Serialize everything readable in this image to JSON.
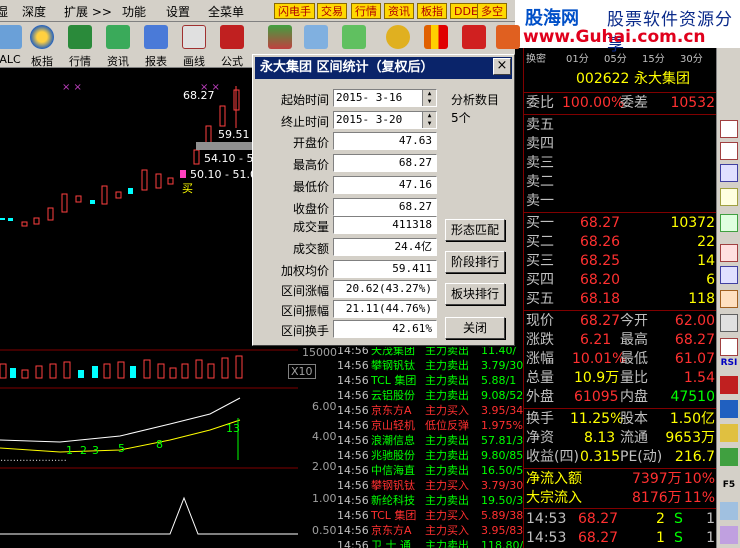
{
  "menubar": {
    "items": [
      "湿",
      "深度",
      "扩展 >>",
      "功能",
      "设置",
      "全菜单"
    ],
    "quick_buttons": [
      "闪电手",
      "交易",
      "行情",
      "资讯",
      "板指",
      "DDE",
      "多空"
    ]
  },
  "logo": {
    "cn1": "股海网",
    "cn2": "股票软件资源分享",
    "url": "www.Guhai.com.cn"
  },
  "toolbar": {
    "tools": [
      "ALC",
      "板指",
      "行情",
      "资讯",
      "报表",
      "画线",
      "公式"
    ]
  },
  "chart": {
    "price_labels": [
      "68.27",
      "59.51",
      "54.10 - 5",
      "50.10 - 51.0"
    ],
    "buy_mark": "买",
    "axis_labels": {
      "a1": "15000",
      "a2": "X10",
      "a3": "6.00",
      "a4": "4.00",
      "a5": "2.00",
      "a6": "1.00",
      "a7": "0.50"
    },
    "indicator_numbers": [
      "1",
      "2",
      "3",
      "5",
      "8",
      "13"
    ]
  },
  "dialog": {
    "title": "永大集团  区间统计（复权后）",
    "close": "×",
    "start_label": "起始时间",
    "start_value": "2015- 3-16",
    "end_label": "终止时间",
    "end_value": "2015- 3-20",
    "days_label": "分析数目",
    "days_value": "5个",
    "fields": [
      {
        "label": "开盘价",
        "value": "47.63"
      },
      {
        "label": "最高价",
        "value": "68.27"
      },
      {
        "label": "最低价",
        "value": "47.16"
      },
      {
        "label": "收盘价",
        "value": "68.27"
      },
      {
        "label": "成交量",
        "value": "411318"
      },
      {
        "label": "成交额",
        "value": "24.4亿"
      },
      {
        "label": "加权均价",
        "value": "59.411"
      },
      {
        "label": "区间涨幅",
        "value": "20.62(43.27%)"
      },
      {
        "label": "区间振幅",
        "value": "21.11(44.76%)"
      },
      {
        "label": "区间换手",
        "value": "42.61%"
      }
    ],
    "buttons": [
      "形态匹配",
      "阶段排行",
      "板块排行",
      "关闭"
    ]
  },
  "ticker": [
    {
      "time": "14:56",
      "name": "天茂集团",
      "action": "主力卖出",
      "val": "11.40/"
    },
    {
      "time": "14:56",
      "name": "攀钢钒钛",
      "action": "主力卖出",
      "val": "3.79/30"
    },
    {
      "time": "14:56",
      "name": "TCL 集团",
      "action": "主力卖出",
      "val": "5.88/1"
    },
    {
      "time": "14:56",
      "name": "云铝股份",
      "action": "主力卖出",
      "val": "9.08/52"
    },
    {
      "time": "14:56",
      "name": "京东方A",
      "action": "主力买入",
      "val": "3.95/34"
    },
    {
      "time": "14:56",
      "name": "京山轻机",
      "action": "低位反弹",
      "val": "1.975%"
    },
    {
      "time": "14:56",
      "name": "浪潮信息",
      "action": "主力卖出",
      "val": "57.81/3"
    },
    {
      "time": "14:56",
      "name": "兆驰股份",
      "action": "主力卖出",
      "val": "9.80/85"
    },
    {
      "time": "14:56",
      "name": "中信海直",
      "action": "主力卖出",
      "val": "16.50/5"
    },
    {
      "time": "14:56",
      "name": "攀钢钒钛",
      "action": "主力买入",
      "val": "3.79/30"
    },
    {
      "time": "14:56",
      "name": "新纶科技",
      "action": "主力卖出",
      "val": "19.50/3"
    },
    {
      "time": "14:56",
      "name": "TCL 集团",
      "action": "主力买入",
      "val": "5.89/38"
    },
    {
      "time": "14:56",
      "name": "京东方A",
      "action": "主力买入",
      "val": "3.95/83"
    },
    {
      "time": "14:56",
      "name": "卫 士 通",
      "action": "主力卖出",
      "val": "118.80/"
    }
  ],
  "panel": {
    "tabs": [
      "换密",
      "01分",
      "05分",
      "15分",
      "30分"
    ],
    "code": "002622",
    "name": "永大集团",
    "weibi_label": "委比",
    "weibi_value": "100.00%",
    "weicha_label": "委差",
    "weicha_value": "10532",
    "sells": [
      "卖五",
      "卖四",
      "卖三",
      "卖二",
      "卖一"
    ],
    "buys": [
      {
        "label": "买一",
        "price": "68.27",
        "vol": "10372"
      },
      {
        "label": "买二",
        "price": "68.26",
        "vol": "22"
      },
      {
        "label": "买三",
        "price": "68.25",
        "vol": "14"
      },
      {
        "label": "买四",
        "price": "68.20",
        "vol": "6"
      },
      {
        "label": "买五",
        "price": "68.18",
        "vol": "118"
      }
    ],
    "stats": [
      {
        "l1": "现价",
        "v1": "68.27",
        "l2": "今开",
        "v2": "62.00",
        "c1": "#ff3030",
        "c2": "#ff3030"
      },
      {
        "l1": "涨跌",
        "v1": "6.21",
        "l2": "最高",
        "v2": "68.27",
        "c1": "#ff3030",
        "c2": "#ff3030"
      },
      {
        "l1": "涨幅",
        "v1": "10.01%",
        "l2": "最低",
        "v2": "61.07",
        "c1": "#ff3030",
        "c2": "#ff3030"
      },
      {
        "l1": "总量",
        "v1": "10.9万",
        "l2": "量比",
        "v2": "1.54",
        "c1": "#ffff00",
        "c2": "#ff3030"
      },
      {
        "l1": "外盘",
        "v1": "61095",
        "l2": "内盘",
        "v2": "47510",
        "c1": "#ff3030",
        "c2": "#00ff00"
      }
    ],
    "stats2": [
      {
        "l1": "换手",
        "v1": "11.25%",
        "l2": "股本",
        "v2": "1.50亿"
      },
      {
        "l1": "净资",
        "v1": "8.13",
        "l2": "流通",
        "v2": "9653万"
      },
      {
        "l1": "收益(四)",
        "v1": "0.315",
        "l2": "PE(动)",
        "v2": "216.7"
      }
    ],
    "flows": [
      {
        "label": "净流入额",
        "value": "7397万",
        "pct": "10%"
      },
      {
        "label": "大宗流入",
        "value": "8176万",
        "pct": "11%"
      }
    ],
    "trades": [
      {
        "time": "14:53",
        "price": "68.27",
        "vol": "2",
        "dir": "S",
        "n": "1"
      },
      {
        "time": "14:53",
        "price": "68.27",
        "vol": "1",
        "dir": "S",
        "n": "1"
      },
      {
        "time": "14:54",
        "price": "68.27",
        "vol": "",
        "dir": "",
        "n": ""
      }
    ]
  },
  "vtool": {
    "buttons": [
      "RSI",
      "F5"
    ]
  }
}
